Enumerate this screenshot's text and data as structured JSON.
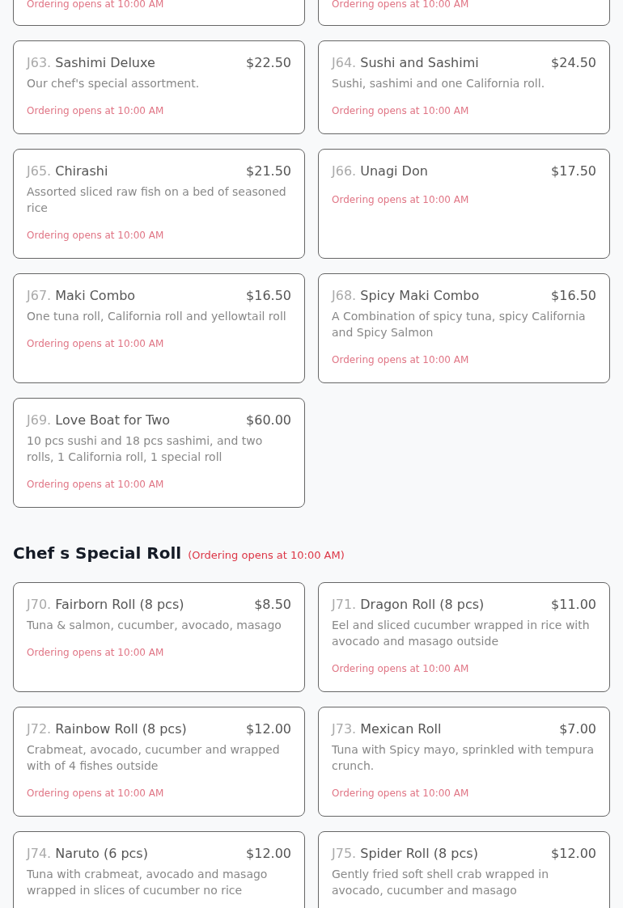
{
  "sections": [
    {
      "items": [
        {
          "notice": "Ordering opens at 10:00 AM"
        },
        {
          "notice": "Ordering opens at 10:00 AM"
        },
        {
          "code": "J63.",
          "name": "Sashimi Deluxe",
          "price": "$22.50",
          "description": "Our chef's special assortment.",
          "notice": "Ordering opens at 10:00 AM"
        },
        {
          "code": "J64.",
          "name": "Sushi and Sashimi",
          "price": "$24.50",
          "description": "Sushi, sashimi and one California roll.",
          "notice": "Ordering opens at 10:00 AM"
        },
        {
          "code": "J65.",
          "name": "Chirashi",
          "price": "$21.50",
          "description": "Assorted sliced raw fish on a bed of seasoned rice",
          "notice": "Ordering opens at 10:00 AM"
        },
        {
          "code": "J66.",
          "name": "Unagi Don",
          "price": "$17.50",
          "notice": "Ordering opens at 10:00 AM"
        },
        {
          "code": "J67.",
          "name": "Maki Combo",
          "price": "$16.50",
          "description": "One tuna roll, California roll and yellowtail roll",
          "notice": "Ordering opens at 10:00 AM"
        },
        {
          "code": "J68.",
          "name": "Spicy Maki Combo",
          "price": "$16.50",
          "description": "A Combination of spicy tuna, spicy California and Spicy Salmon",
          "notice": "Ordering opens at 10:00 AM"
        },
        {
          "code": "J69.",
          "name": "Love Boat for Two",
          "price": "$60.00",
          "description": "10 pcs sushi and 18 pcs sashimi, and two rolls, 1 California roll, 1 special roll",
          "notice": "Ordering opens at 10:00 AM"
        }
      ]
    },
    {
      "heading": "Chef s Special Roll",
      "notice": "(Ordering opens at 10:00 AM)",
      "items": [
        {
          "code": "J70.",
          "name": "Fairborn Roll (8 pcs)",
          "price": "$8.50",
          "description": "Tuna & salmon, cucumber, avocado, masago",
          "notice": "Ordering opens at 10:00 AM"
        },
        {
          "code": "J71.",
          "name": "Dragon Roll (8 pcs)",
          "price": "$11.00",
          "description": "Eel and sliced cucumber wrapped in rice with avocado and masago outside",
          "notice": "Ordering opens at 10:00 AM"
        },
        {
          "code": "J72.",
          "name": "Rainbow Roll (8 pcs)",
          "price": "$12.00",
          "description": "Crabmeat, avocado, cucumber and wrapped with of 4 fishes outside",
          "notice": "Ordering opens at 10:00 AM"
        },
        {
          "code": "J73.",
          "name": "Mexican Roll",
          "price": "$7.00",
          "description": "Tuna with Spicy mayo, sprinkled with tempura crunch.",
          "notice": "Ordering opens at 10:00 AM"
        },
        {
          "code": "J74.",
          "name": "Naruto (6 pcs)",
          "price": "$12.00",
          "description": "Tuna with crabmeat, avocado and masago wrapped in slices of cucumber no rice"
        },
        {
          "code": "J75.",
          "name": "Spider Roll (8 pcs)",
          "price": "$12.00",
          "description": "Gently fried soft shell crab wrapped in avocado, cucumber and masago"
        }
      ]
    }
  ]
}
